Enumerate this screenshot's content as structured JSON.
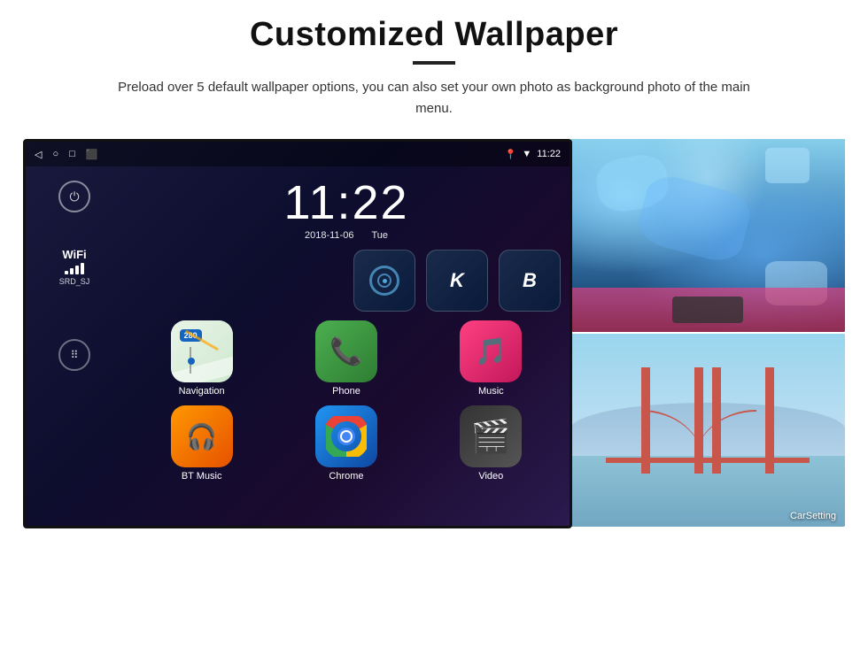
{
  "header": {
    "title": "Customized Wallpaper",
    "description": "Preload over 5 default wallpaper options, you can also set your own photo as background photo of the main menu."
  },
  "status_bar": {
    "time": "11:22",
    "nav_icons": [
      "◁",
      "○",
      "□",
      "⬜"
    ],
    "right_icons": [
      "📍",
      "▼"
    ]
  },
  "clock": {
    "time": "11:22",
    "date": "2018-11-06",
    "day": "Tue"
  },
  "wifi": {
    "label": "WiFi",
    "ssid": "SRD_SJ"
  },
  "apps": [
    {
      "id": "navigation",
      "label": "Navigation",
      "type": "nav"
    },
    {
      "id": "phone",
      "label": "Phone",
      "type": "phone"
    },
    {
      "id": "music",
      "label": "Music",
      "type": "music"
    },
    {
      "id": "bt-music",
      "label": "BT Music",
      "type": "bt"
    },
    {
      "id": "chrome",
      "label": "Chrome",
      "type": "chrome"
    },
    {
      "id": "video",
      "label": "Video",
      "type": "video"
    }
  ],
  "wallpapers": [
    {
      "id": "ice",
      "label": "Ice/Blue landscape"
    },
    {
      "id": "bridge",
      "label": "Golden Gate Bridge"
    }
  ],
  "carsetting": {
    "label": "CarSetting"
  }
}
